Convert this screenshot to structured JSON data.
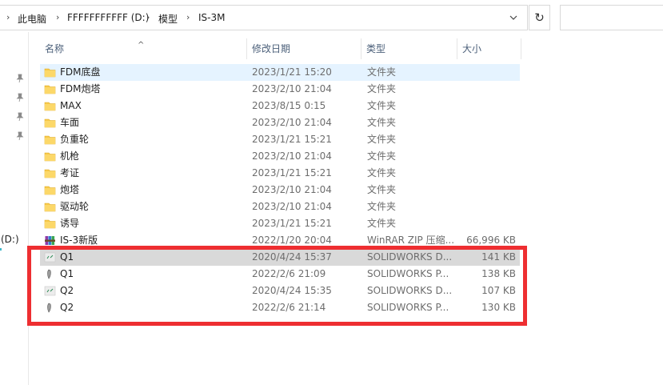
{
  "address": {
    "crumbs": [
      "此电脑",
      "FFFFFFFFFFF (D:)",
      "模型",
      "IS-3M"
    ],
    "refresh_icon": "↻"
  },
  "navpane": {
    "drive_label": "(D:)"
  },
  "columns": {
    "name": "名称",
    "date": "修改日期",
    "type": "类型",
    "size": "大小",
    "sort_indicator": "^"
  },
  "files": [
    {
      "name": "FDM底盘",
      "date": "2023/1/21 15:20",
      "type": "文件夹",
      "size": "",
      "icon": "folder-icon",
      "state": "hover"
    },
    {
      "name": "FDM炮塔",
      "date": "2023/2/10 21:04",
      "type": "文件夹",
      "size": "",
      "icon": "folder-icon",
      "state": ""
    },
    {
      "name": "MAX",
      "date": "2023/8/15 0:15",
      "type": "文件夹",
      "size": "",
      "icon": "folder-icon",
      "state": ""
    },
    {
      "name": "车面",
      "date": "2023/2/10 21:04",
      "type": "文件夹",
      "size": "",
      "icon": "folder-icon",
      "state": ""
    },
    {
      "name": "负重轮",
      "date": "2023/1/21 15:21",
      "type": "文件夹",
      "size": "",
      "icon": "folder-icon",
      "state": ""
    },
    {
      "name": "机枪",
      "date": "2023/2/10 21:04",
      "type": "文件夹",
      "size": "",
      "icon": "folder-icon",
      "state": ""
    },
    {
      "name": "考证",
      "date": "2023/1/21 15:21",
      "type": "文件夹",
      "size": "",
      "icon": "folder-icon",
      "state": ""
    },
    {
      "name": "炮塔",
      "date": "2023/2/10 21:04",
      "type": "文件夹",
      "size": "",
      "icon": "folder-icon",
      "state": ""
    },
    {
      "name": "驱动轮",
      "date": "2023/2/10 21:04",
      "type": "文件夹",
      "size": "",
      "icon": "folder-icon",
      "state": ""
    },
    {
      "name": "诱导",
      "date": "2023/1/21 15:21",
      "type": "文件夹",
      "size": "",
      "icon": "folder-icon",
      "state": ""
    },
    {
      "name": "IS-3新版",
      "date": "2022/1/20 20:04",
      "type": "WinRAR ZIP 压缩...",
      "size": "66,996 KB",
      "icon": "winrar-icon",
      "state": ""
    },
    {
      "name": "Q1",
      "date": "2020/4/24 15:37",
      "type": "SOLIDWORKS D...",
      "size": "141 KB",
      "icon": "solidworks-drawing-icon",
      "state": "selected"
    },
    {
      "name": "Q1",
      "date": "2022/2/6 21:09",
      "type": "SOLIDWORKS P...",
      "size": "138 KB",
      "icon": "solidworks-part-icon",
      "state": ""
    },
    {
      "name": "Q2",
      "date": "2020/4/24 15:35",
      "type": "SOLIDWORKS D...",
      "size": "107 KB",
      "icon": "solidworks-drawing-icon",
      "state": ""
    },
    {
      "name": "Q2",
      "date": "2022/2/6 21:14",
      "type": "SOLIDWORKS P...",
      "size": "130 KB",
      "icon": "solidworks-part-icon",
      "state": ""
    }
  ],
  "colors": {
    "folder": "#f7c94a",
    "hover": "#e5f3ff",
    "selected": "#d9d9d9",
    "annotation": "#ee2e31"
  }
}
